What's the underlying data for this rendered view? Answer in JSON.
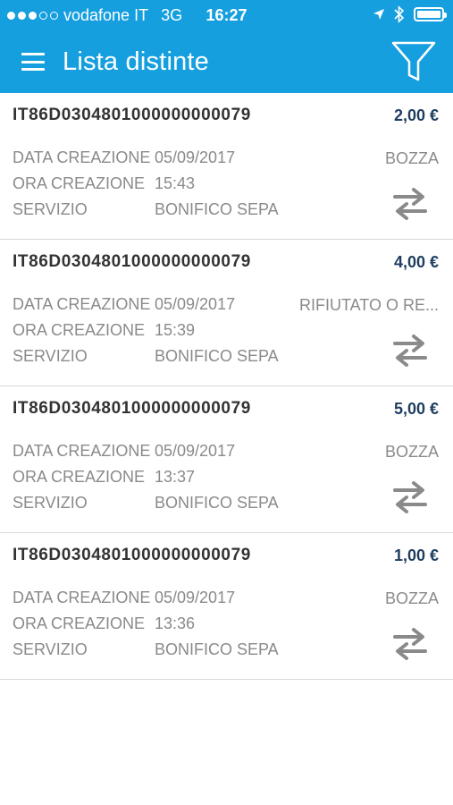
{
  "statusbar": {
    "carrier": "vodafone IT",
    "network": "3G",
    "time": "16:27",
    "signal_full": 3,
    "signal_total": 5,
    "battery_level": 1.0
  },
  "navbar": {
    "title": "Lista distinte",
    "menu_icon": "hamburger-icon",
    "filter_icon": "filter-icon"
  },
  "labels": {
    "date": "DATA CREAZIONE",
    "time": "ORA CREAZIONE",
    "service": "SERVIZIO"
  },
  "items": [
    {
      "iban": "IT86D0304801000000000079",
      "amount": "2,00 €",
      "date": "05/09/2017",
      "time": "15:43",
      "service": "BONIFICO SEPA",
      "status": "BOZZA"
    },
    {
      "iban": "IT86D0304801000000000079",
      "amount": "4,00 €",
      "date": "05/09/2017",
      "time": "15:39",
      "service": "BONIFICO SEPA",
      "status": "RIFIUTATO O RE..."
    },
    {
      "iban": "IT86D0304801000000000079",
      "amount": "5,00 €",
      "date": "05/09/2017",
      "time": "13:37",
      "service": "BONIFICO SEPA",
      "status": "BOZZA"
    },
    {
      "iban": "IT86D0304801000000000079",
      "amount": "1,00 €",
      "date": "05/09/2017",
      "time": "13:36",
      "service": "BONIFICO SEPA",
      "status": "BOZZA"
    }
  ],
  "colors": {
    "header": "#159fdf",
    "amount": "#1e3d5f",
    "muted": "#8a8a8a"
  }
}
